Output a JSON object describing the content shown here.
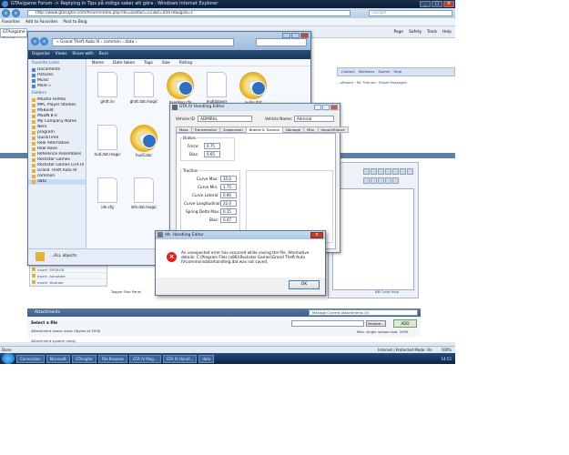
{
  "ie": {
    "title": "GTAsigame Forum -> Replying in Tips på mõtge saker att göra - Windows Internet Explorer",
    "address": "http://www.gtasigfor.com/forum/index.php?do=post&f=123&t=45678&qpid=1",
    "search_placeholder": "Google",
    "favorites": [
      "Favorites",
      "Add to Favorites",
      "Post to Blog"
    ],
    "tab": "GTAsigame Forum",
    "tools": [
      "Page",
      "Safety",
      "Tools",
      "Help"
    ]
  },
  "forum": {
    "top_links": [
      "Contact",
      "Members",
      "Search",
      "Help"
    ],
    "breadcrumb": "...oftware › Mc Friends › Sheet Messages",
    "insert_items": [
      "Insert: Quote",
      "Insert: Code Link",
      "Insert: Font Link",
      "Insert: CODEBOX",
      "Insert: SPOILER",
      "Insert: Annotate",
      "Insert: Youtube"
    ],
    "toggle_side": "Toggle Side Panel",
    "code_help": "BB Code Help",
    "attachments_label": "Attachments",
    "manage_attachments": "Manage Current Attachments (0)",
    "select_file": "Select a file",
    "attachment_info": "Attachment space used: 0bytes of 200K",
    "browse": "Browse...",
    "add": "ADD",
    "max_info": "Max. single upload size: 200K",
    "attachment_system": "Attachment system ready"
  },
  "explorer": {
    "path": "« Grand Theft Auto III › common › data ›",
    "toolbar": [
      "Organize",
      "Views",
      "Share with",
      "Burn"
    ],
    "side_header": "Favorite Links",
    "favorites": [
      "Documents",
      "Pictures",
      "Music",
      "More »"
    ],
    "folders_header": "Folders",
    "folders": [
      "Mozilla Firefox",
      "MPC Player Utilities",
      "MSBuild",
      "MSDN 8.0",
      "My Company Name",
      "Nero",
      "program",
      "QuickTime",
      "Real Alternative",
      "Real Rave",
      "Reference Assemblies",
      "Rockstar Games",
      "Rockstar Games GTA IV",
      "Grand Theft Auto III",
      "common",
      "data"
    ],
    "columns": [
      "Name",
      "Date taken",
      "Tags",
      "Size",
      "Rating"
    ],
    "files": [
      "ghdt.ini",
      "ghdt.dat.magic",
      "handling.cfg",
      "multiplayer",
      "audio.dat",
      "hudColor",
      "hud.dat.magic",
      "hudColor",
      "ide.cfg",
      "info.dat.magic"
    ],
    "footer_name": "...ALL objects"
  },
  "gta_editor": {
    "title": "GTA IV Handling Editor",
    "vehicle_id_label": "Vehicle ID",
    "vehicle_id_value": "ADMIRAL",
    "vehicle_name_label": "Vehicle Name:",
    "vehicle_name_value": "Admiral",
    "tabs": [
      "Mass",
      "Transmission",
      "Suspension",
      "Brakes & Traction",
      "Damage",
      "Misc",
      "Import/Export"
    ],
    "brakes_label": "Brakes",
    "force_label": "Force:",
    "force_value": "0.75",
    "bias_label": "Bias:",
    "bias_value": "0.65",
    "traction_label": "Traction",
    "fields": [
      {
        "label": "Curve Max:",
        "value": "35.0"
      },
      {
        "label": "Curve Min:",
        "value": "1.75"
      },
      {
        "label": "Curve Lateral:",
        "value": "0.90"
      },
      {
        "label": "Curve Longitudinal:",
        "value": "22.0"
      },
      {
        "label": "Spring Delta Max:",
        "value": "0.15"
      },
      {
        "label": "Bias:",
        "value": "0.47"
      }
    ]
  },
  "error_dialog": {
    "title": "Alt. Handling Editor",
    "message": "An unexpected error has occurred while saving the file. Alternative details: C:\\Program Files (x86)\\Rockstar Games\\Grand Theft Auto IV\\common\\data\\handling.dat was not saved.",
    "ok": "OK"
  },
  "status_bar": {
    "left": "Done",
    "zone": "Internet | Protected Mode: On",
    "zoom": "100%"
  },
  "taskbar": {
    "tasks": [
      "Connection",
      "Microsoft",
      "GTAsigfor",
      "File Browser",
      "GTA IV Mag...",
      "GTA IV Handl...",
      "data"
    ],
    "tray": "14:52"
  }
}
